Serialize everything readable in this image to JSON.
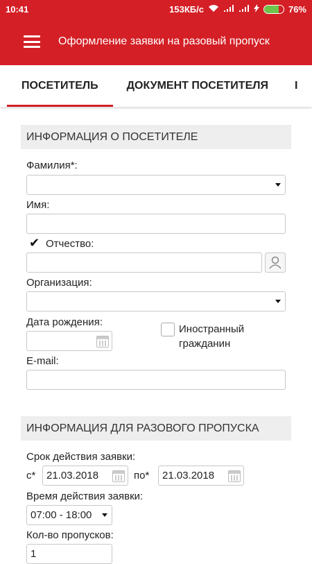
{
  "status_bar": {
    "time": "10:41",
    "speed": "153КБ/с",
    "battery_percent": "76%",
    "battery_level": 0.76,
    "battery_color": "#6ec34a"
  },
  "app_bar": {
    "title": "Оформление заявки на разовый пропуск",
    "menu_icon": "hamburger-menu-icon",
    "color": "#d41f26"
  },
  "tabs": [
    {
      "label": "ПОСЕТИТЕЛЬ",
      "active": true
    },
    {
      "label": "ДОКУМЕНТ ПОСЕТИТЕЛЯ",
      "active": false
    },
    {
      "label": "I",
      "active": false
    }
  ],
  "visitor_section": {
    "header": "ИНФОРМАЦИЯ О ПОСЕТИТЕЛЕ",
    "last_name_label": "Фамилия*:",
    "last_name_value": "",
    "first_name_label": "Имя:",
    "first_name_value": "",
    "patronymic_label": "Отчество:",
    "patronymic_checked": true,
    "patronymic_value": "",
    "organization_label": "Организация:",
    "organization_value": "",
    "birth_date_label": "Дата рождения:",
    "birth_date_value": "",
    "foreign_citizen_label": "Иностранный гражданин",
    "foreign_citizen_checked": false,
    "email_label": "E-mail:",
    "email_value": ""
  },
  "pass_section": {
    "header": "ИНФОРМАЦИЯ ДЛЯ РАЗОВОГО ПРОПУСКА",
    "validity_label": "Срок действия заявки:",
    "from_label": "с*",
    "from_value": "21.03.2018",
    "to_label": "по*",
    "to_value": "21.03.2018",
    "time_label": "Время действия заявки:",
    "time_value": "07:00 - 18:00",
    "count_label": "Кол-во пропусков:",
    "count_value": "1"
  }
}
